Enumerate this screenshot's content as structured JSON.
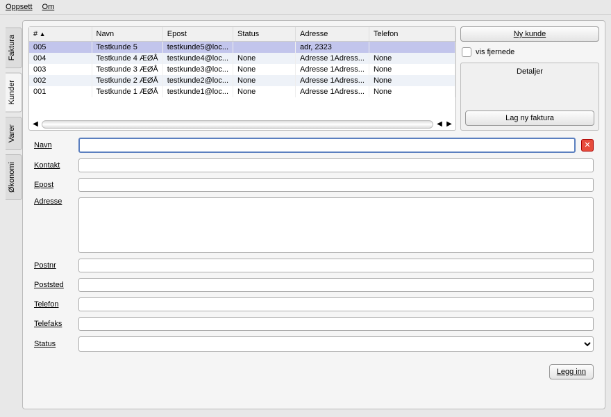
{
  "menu": {
    "oppsett": "Oppsett",
    "om": "Om"
  },
  "tabs": [
    "Faktura",
    "Kunder",
    "Varer",
    "Økonomi"
  ],
  "cols": {
    "id": "#",
    "navn": "Navn",
    "epost": "Epost",
    "status": "Status",
    "adresse": "Adresse",
    "telefon": "Telefon"
  },
  "rows": [
    {
      "id": "005",
      "navn": "Testkunde 5",
      "epost": "testkunde5@loc...",
      "status": "",
      "adresse": "adr,  2323",
      "telefon": ""
    },
    {
      "id": "004",
      "navn": "Testkunde 4 ÆØÅ",
      "epost": "testkunde4@loc...",
      "status": "None",
      "adresse": "Adresse 1Adress...",
      "telefon": "None"
    },
    {
      "id": "003",
      "navn": "Testkunde 3 ÆØÅ",
      "epost": "testkunde3@loc...",
      "status": "None",
      "adresse": "Adresse 1Adress...",
      "telefon": "None"
    },
    {
      "id": "002",
      "navn": "Testkunde 2 ÆØÅ",
      "epost": "testkunde2@loc...",
      "status": "None",
      "adresse": "Adresse 1Adress...",
      "telefon": "None"
    },
    {
      "id": "001",
      "navn": "Testkunde 1 ÆØÅ",
      "epost": "testkunde1@loc...",
      "status": "None",
      "adresse": "Adresse 1Adress...",
      "telefon": "None"
    }
  ],
  "side": {
    "nykunde": "Ny kunde",
    "visfjernede": "vis fjernede",
    "detaljer": "Detaljer",
    "lagnyfaktura": "Lag ny faktura"
  },
  "labels": {
    "navn": "Navn",
    "kontakt": "Kontakt",
    "epost": "Epost",
    "adresse": "Adresse",
    "postnr": "Postnr",
    "poststed": "Poststed",
    "telefon": "Telefon",
    "telefaks": "Telefaks",
    "status": "Status"
  },
  "legginn": "Legg inn"
}
